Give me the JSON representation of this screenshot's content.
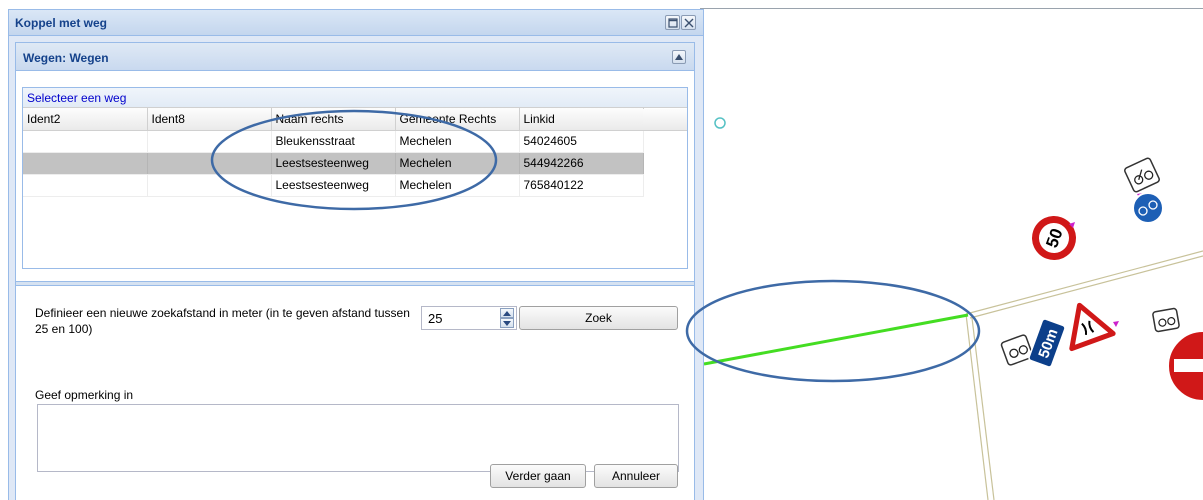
{
  "dialog": {
    "title": "Koppel met weg",
    "maximize_icon": "maximize-icon",
    "close_icon": "close-icon"
  },
  "panel": {
    "title": "Wegen: Wegen",
    "collapse_icon": "chevron-up-icon",
    "grid_caption": "Selecteer een weg",
    "columns": [
      "Ident2",
      "Ident8",
      "Naam rechts",
      "Gemeente Rechts",
      "Linkid"
    ],
    "rows": [
      {
        "ident2": "",
        "ident8": "",
        "naam": "Bleukensstraat",
        "gemeente": "Mechelen",
        "linkid": "54024605",
        "selected": false
      },
      {
        "ident2": "",
        "ident8": "",
        "naam": "Leestsesteenweg",
        "gemeente": "Mechelen",
        "linkid": "544942266",
        "selected": true
      },
      {
        "ident2": "",
        "ident8": "",
        "naam": "Leestsesteenweg",
        "gemeente": "Mechelen",
        "linkid": "765840122",
        "selected": false
      }
    ]
  },
  "form": {
    "search_label": "Definieer een nieuwe zoekafstand in meter (in te geven afstand tussen 25 en 100)",
    "distance_value": "25",
    "search_button": "Zoek",
    "remark_label": "Geef opmerking in",
    "remark_value": "",
    "continue_button": "Verder gaan",
    "cancel_button": "Annuleer"
  },
  "map": {
    "road_color": "#c8c29a",
    "selected_link_color": "#44dd22",
    "annotation_color": "#3e6aa6",
    "signs": {
      "speed_limit": "50",
      "distance_plate": "50m"
    }
  }
}
